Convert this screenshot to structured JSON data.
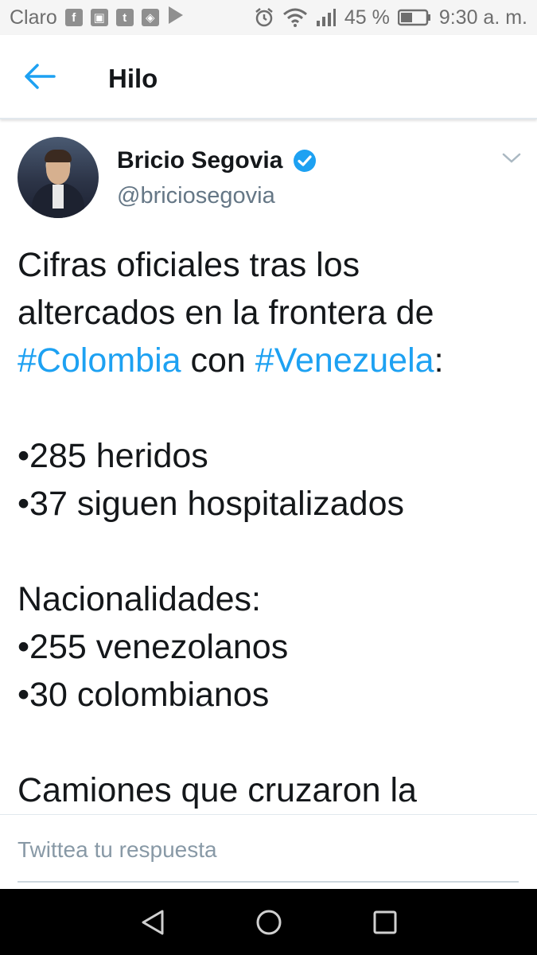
{
  "status_bar": {
    "carrier": "Claro",
    "battery": "45 %",
    "time": "9:30 a. m."
  },
  "header": {
    "title": "Hilo"
  },
  "tweet": {
    "author_name": "Bricio Segovia",
    "handle": "@briciosegovia",
    "verified": true,
    "text": {
      "l1": "Cifras oficiales tras los",
      "l2": "altercados en la frontera de",
      "l3_tag1": "#Colombia",
      "l3_mid": " con ",
      "l3_tag2": "#Venezuela",
      "l3_end": ":",
      "l4": "•285 heridos",
      "l5": "•37 siguen hospitalizados",
      "l6": "Nacionalidades:",
      "l7": "•255 venezolanos",
      "l8": "•30 colombianos",
      "l9": "Camiones que cruzaron la"
    }
  },
  "reply": {
    "placeholder": "Twittea tu respuesta"
  },
  "colors": {
    "accent": "#1da1f2",
    "text": "#14171a",
    "secondary": "#657786"
  }
}
